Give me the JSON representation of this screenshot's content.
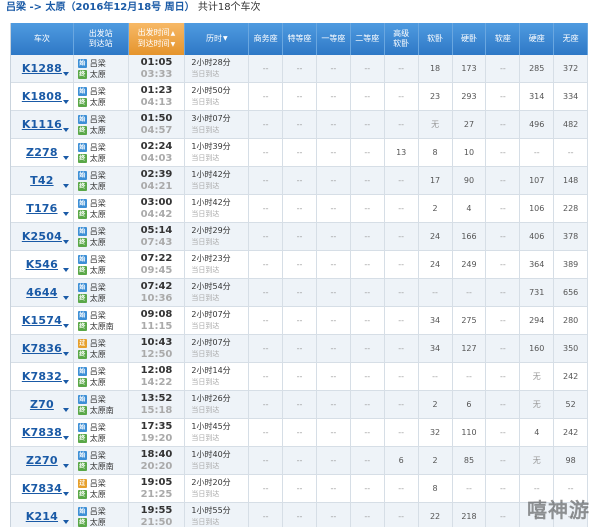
{
  "title": {
    "route": "吕梁 -> 太原（2016年12月18号 周日）",
    "total": "共计18个车次"
  },
  "header": {
    "train": "车次",
    "station_top": "出发站",
    "station_bottom": "到达站",
    "time_top": "出发时间",
    "time_bottom": "到达时间",
    "duration": "历时",
    "business": "商务座",
    "special": "特等座",
    "first": "一等座",
    "second": "二等座",
    "soft_sleeper_top": "高级",
    "soft_sleeper_bottom": "软卧",
    "soft_berth": "软卧",
    "hard_berth": "硬卧",
    "soft_seat": "软座",
    "hard_seat": "硬座",
    "no_seat": "无座"
  },
  "colors": {
    "header_blue": "#2e78c6",
    "header_orange": "#e5942c",
    "link_blue": "#1a5aa6",
    "station_start_icon": "#3d8fd6",
    "station_pass_icon": "#e6a02d",
    "station_end_icon": "#5aa848"
  },
  "rows": [
    {
      "no": "K1288",
      "from": "吕梁",
      "to": "太原",
      "from_type": "始",
      "to_type": "终",
      "dep": "01:05",
      "arr": "03:33",
      "dur": "2小时28分",
      "dur_sub": "当日到达",
      "bus": "--",
      "spe": "--",
      "fir": "--",
      "sec": "--",
      "hss": "--",
      "sb": "18",
      "hb": "173",
      "ss": "--",
      "hs": "285",
      "ns": "372"
    },
    {
      "no": "K1808",
      "from": "吕梁",
      "to": "太原",
      "from_type": "始",
      "to_type": "终",
      "dep": "01:23",
      "arr": "04:13",
      "dur": "2小时50分",
      "dur_sub": "当日到达",
      "bus": "--",
      "spe": "--",
      "fir": "--",
      "sec": "--",
      "hss": "--",
      "sb": "23",
      "hb": "293",
      "ss": "--",
      "hs": "314",
      "ns": "334"
    },
    {
      "no": "K1116",
      "from": "吕梁",
      "to": "太原",
      "from_type": "始",
      "to_type": "终",
      "dep": "01:50",
      "arr": "04:57",
      "dur": "3小时07分",
      "dur_sub": "当日到达",
      "bus": "--",
      "spe": "--",
      "fir": "--",
      "sec": "--",
      "hss": "--",
      "sb": "无",
      "hb": "27",
      "ss": "--",
      "hs": "496",
      "ns": "482"
    },
    {
      "no": "Z278",
      "from": "吕梁",
      "to": "太原",
      "from_type": "始",
      "to_type": "终",
      "dep": "02:24",
      "arr": "04:03",
      "dur": "1小时39分",
      "dur_sub": "当日到达",
      "bus": "--",
      "spe": "--",
      "fir": "--",
      "sec": "--",
      "hss": "13",
      "sb": "8",
      "hb": "10",
      "ss": "--",
      "hs": "--",
      "ns": "--"
    },
    {
      "no": "T42",
      "from": "吕梁",
      "to": "太原",
      "from_type": "始",
      "to_type": "终",
      "dep": "02:39",
      "arr": "04:21",
      "dur": "1小时42分",
      "dur_sub": "当日到达",
      "bus": "--",
      "spe": "--",
      "fir": "--",
      "sec": "--",
      "hss": "--",
      "sb": "17",
      "hb": "90",
      "ss": "--",
      "hs": "107",
      "ns": "148"
    },
    {
      "no": "T176",
      "from": "吕梁",
      "to": "太原",
      "from_type": "始",
      "to_type": "终",
      "dep": "03:00",
      "arr": "04:42",
      "dur": "1小时42分",
      "dur_sub": "当日到达",
      "bus": "--",
      "spe": "--",
      "fir": "--",
      "sec": "--",
      "hss": "--",
      "sb": "2",
      "hb": "4",
      "ss": "--",
      "hs": "106",
      "ns": "228"
    },
    {
      "no": "K2504",
      "from": "吕梁",
      "to": "太原",
      "from_type": "始",
      "to_type": "终",
      "dep": "05:14",
      "arr": "07:43",
      "dur": "2小时29分",
      "dur_sub": "当日到达",
      "bus": "--",
      "spe": "--",
      "fir": "--",
      "sec": "--",
      "hss": "--",
      "sb": "24",
      "hb": "166",
      "ss": "--",
      "hs": "406",
      "ns": "378"
    },
    {
      "no": "K546",
      "from": "吕梁",
      "to": "太原",
      "from_type": "始",
      "to_type": "终",
      "dep": "07:22",
      "arr": "09:45",
      "dur": "2小时23分",
      "dur_sub": "当日到达",
      "bus": "--",
      "spe": "--",
      "fir": "--",
      "sec": "--",
      "hss": "--",
      "sb": "24",
      "hb": "249",
      "ss": "--",
      "hs": "364",
      "ns": "389"
    },
    {
      "no": "4644",
      "from": "吕梁",
      "to": "太原",
      "from_type": "始",
      "to_type": "终",
      "dep": "07:42",
      "arr": "10:36",
      "dur": "2小时54分",
      "dur_sub": "当日到达",
      "bus": "--",
      "spe": "--",
      "fir": "--",
      "sec": "--",
      "hss": "--",
      "sb": "--",
      "hb": "--",
      "ss": "--",
      "hs": "731",
      "ns": "656"
    },
    {
      "no": "K1574",
      "from": "吕梁",
      "to": "太原南",
      "from_type": "始",
      "to_type": "终",
      "dep": "09:08",
      "arr": "11:15",
      "dur": "2小时07分",
      "dur_sub": "当日到达",
      "bus": "--",
      "spe": "--",
      "fir": "--",
      "sec": "--",
      "hss": "--",
      "sb": "34",
      "hb": "275",
      "ss": "--",
      "hs": "294",
      "ns": "280"
    },
    {
      "no": "K7836",
      "from": "吕梁",
      "to": "太原",
      "from_type": "过",
      "to_type": "终",
      "dep": "10:43",
      "arr": "12:50",
      "dur": "2小时07分",
      "dur_sub": "当日到达",
      "bus": "--",
      "spe": "--",
      "fir": "--",
      "sec": "--",
      "hss": "--",
      "sb": "34",
      "hb": "127",
      "ss": "--",
      "hs": "160",
      "ns": "350"
    },
    {
      "no": "K7832",
      "from": "吕梁",
      "to": "太原",
      "from_type": "始",
      "to_type": "终",
      "dep": "12:08",
      "arr": "14:22",
      "dur": "2小时14分",
      "dur_sub": "当日到达",
      "bus": "--",
      "spe": "--",
      "fir": "--",
      "sec": "--",
      "hss": "--",
      "sb": "--",
      "hb": "--",
      "ss": "--",
      "hs": "无",
      "ns": "242"
    },
    {
      "no": "Z70",
      "from": "吕梁",
      "to": "太原南",
      "from_type": "始",
      "to_type": "终",
      "dep": "13:52",
      "arr": "15:18",
      "dur": "1小时26分",
      "dur_sub": "当日到达",
      "bus": "--",
      "spe": "--",
      "fir": "--",
      "sec": "--",
      "hss": "--",
      "sb": "2",
      "hb": "6",
      "ss": "--",
      "hs": "无",
      "ns": "52"
    },
    {
      "no": "K7838",
      "from": "吕梁",
      "to": "太原",
      "from_type": "始",
      "to_type": "终",
      "dep": "17:35",
      "arr": "19:20",
      "dur": "1小时45分",
      "dur_sub": "当日到达",
      "bus": "--",
      "spe": "--",
      "fir": "--",
      "sec": "--",
      "hss": "--",
      "sb": "32",
      "hb": "110",
      "ss": "--",
      "hs": "4",
      "ns": "242"
    },
    {
      "no": "Z270",
      "from": "吕梁",
      "to": "太原南",
      "from_type": "始",
      "to_type": "终",
      "dep": "18:40",
      "arr": "20:20",
      "dur": "1小时40分",
      "dur_sub": "当日到达",
      "bus": "--",
      "spe": "--",
      "fir": "--",
      "sec": "--",
      "hss": "6",
      "sb": "2",
      "hb": "85",
      "ss": "--",
      "hs": "无",
      "ns": "98"
    },
    {
      "no": "K7834",
      "from": "吕梁",
      "to": "太原",
      "from_type": "过",
      "to_type": "终",
      "dep": "19:05",
      "arr": "21:25",
      "dur": "2小时20分",
      "dur_sub": "当日到达",
      "bus": "--",
      "spe": "--",
      "fir": "--",
      "sec": "--",
      "hss": "--",
      "sb": "8",
      "hb": "--",
      "ss": "--",
      "hs": "--",
      "ns": "--"
    },
    {
      "no": "K214",
      "from": "吕梁",
      "to": "太原",
      "from_type": "始",
      "to_type": "终",
      "dep": "19:55",
      "arr": "21:50",
      "dur": "1小时55分",
      "dur_sub": "当日到达",
      "bus": "--",
      "spe": "--",
      "fir": "--",
      "sec": "--",
      "hss": "--",
      "sb": "22",
      "hb": "218",
      "ss": "--",
      "hs": "--",
      "ns": "--"
    }
  ],
  "watermark": "嘻神游"
}
